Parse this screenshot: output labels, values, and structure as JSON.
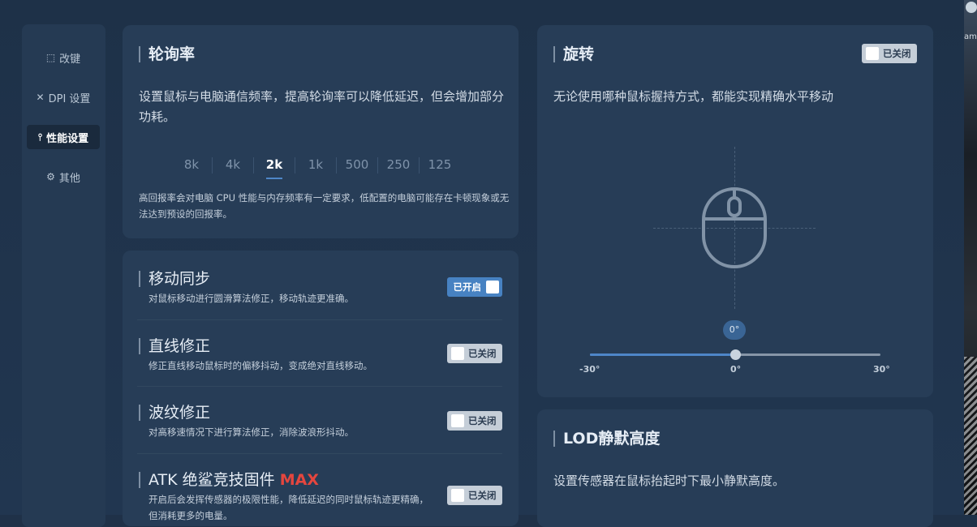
{
  "sidebar": {
    "items": [
      {
        "label": "改键",
        "icon": "keymap-icon"
      },
      {
        "label": "DPI 设置",
        "icon": "dpi-icon"
      },
      {
        "label": "性能设置",
        "icon": "sliders-icon",
        "active": true
      },
      {
        "label": "其他",
        "icon": "gear-icon"
      }
    ]
  },
  "polling": {
    "title": "轮询率",
    "description": "设置鼠标与电脑通信频率，提高轮询率可以降低延迟，但会增加部分功耗。",
    "rates": [
      "8k",
      "4k",
      "2k",
      "1k",
      "500",
      "250",
      "125"
    ],
    "selected": "2k",
    "note": "高回报率会对电脑 CPU 性能与内存频率有一定要求，低配置的电脑可能存在卡顿现象或无法达到预设的回报率。"
  },
  "features": [
    {
      "title": "移动同步",
      "description": "对鼠标移动进行圆滑算法修正，移动轨迹更准确。",
      "toggle": "已开启",
      "on": true
    },
    {
      "title": "直线修正",
      "description": "修正直线移动鼠标时的偏移抖动，变成绝对直线移动。",
      "toggle": "已关闭",
      "on": false
    },
    {
      "title": "波纹修正",
      "description": "对高移速情况下进行算法修正，消除波浪形抖动。",
      "toggle": "已关闭",
      "on": false
    },
    {
      "title": "ATK 绝鲨竞技固件",
      "title_suffix": "MAX",
      "description": "开启后会发挥传感器的极限性能，降低延迟的同时鼠标轨迹更精确，但消耗更多的电量。",
      "toggle": "已关闭",
      "on": false
    }
  ],
  "rotation": {
    "title": "旋转",
    "toggle": "已关闭",
    "description": "无论使用哪种鼠标握持方式，都能实现精确水平移动",
    "value_label": "0°",
    "value": 0,
    "min": -30,
    "max": 30,
    "min_label": "-30°",
    "mid_label": "0°",
    "max_label": "30°"
  },
  "lod": {
    "title": "LOD静默高度",
    "description": "设置传感器在鼠标抬起时下最小静默高度。"
  },
  "edge": {
    "text": "am"
  },
  "colors": {
    "accent": "#4782c2",
    "max_red": "#e5463e",
    "card": "#273d57",
    "background": "#1f3148"
  }
}
